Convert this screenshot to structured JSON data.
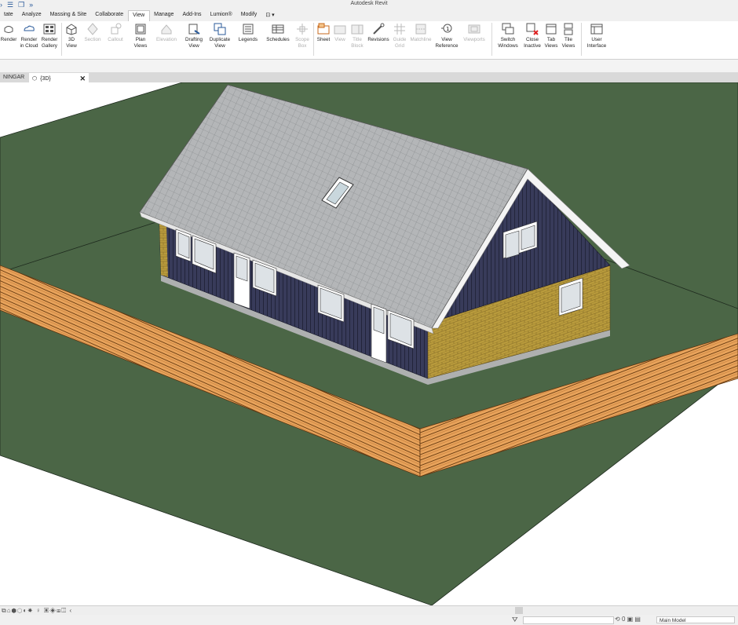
{
  "app": {
    "title": "Autodesk Revit"
  },
  "menu_tabs": [
    "tate",
    "Analyze",
    "Massing & Site",
    "Collaborate",
    "View",
    "Manage",
    "Add-Ins",
    "Lumion®",
    "Modify",
    "⊡ ▾"
  ],
  "active_menu_tab": "View",
  "ribbon": {
    "render": "Render",
    "render_cloud": [
      "Render",
      "in Cloud"
    ],
    "render_gallery": [
      "Render",
      "Gallery"
    ],
    "view3d": [
      "3D",
      "View"
    ],
    "section": "Section",
    "callout": "Callout",
    "plan_views": [
      "Plan",
      "Views"
    ],
    "elevation": "Elevation",
    "drafting_view": [
      "Drafting",
      "View"
    ],
    "duplicate_view": [
      "Duplicate",
      "View"
    ],
    "legends": "Legends",
    "schedules": "Schedules",
    "scope_box": [
      "Scope",
      "Box"
    ],
    "sheet": "Sheet",
    "view": "View",
    "title_block": [
      "Title",
      "Block"
    ],
    "revisions": "Revisions",
    "guide_grid": [
      "Guide",
      "Grid"
    ],
    "matchline": "Matchline",
    "view_reference": [
      "View",
      "Reference"
    ],
    "viewports": "Viewports",
    "switch_windows": [
      "Switch",
      "Windows"
    ],
    "close_inactive": [
      "Close",
      "Inactive"
    ],
    "tab_views": [
      "Tab",
      "Views"
    ],
    "tile_views": [
      "Tile",
      "Views"
    ],
    "user_interface": [
      "User",
      "Interface"
    ]
  },
  "view_tabs": [
    {
      "label": "NINGAR"
    },
    {
      "label": "{3D}",
      "close": "✕"
    }
  ],
  "statusbar": {
    "model": "Main Model",
    "filter_icon": "⛛",
    "zero": "0"
  },
  "colors": {
    "ground": "#4b6646",
    "wall_dark": "#383b5a",
    "brick": "#b99b3c",
    "roof": "#b4b6b8",
    "fence": "#e8a35b"
  }
}
